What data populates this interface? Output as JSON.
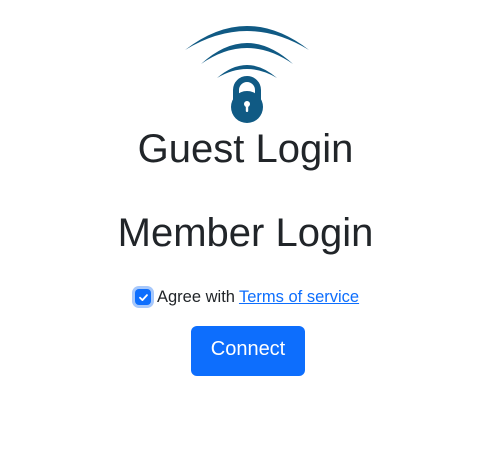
{
  "logo": {
    "icon": "wifi-lock-icon",
    "color": "#105a84"
  },
  "guest_title": "Guest Login",
  "member_title": "Member Login",
  "agree": {
    "checked": true,
    "label": "Agree with",
    "link_text": "Terms of service"
  },
  "connect_button": {
    "label": "Connect"
  },
  "colors": {
    "accent": "#0d6efd",
    "logo": "#105a84",
    "text": "#212529",
    "checkbox_focus_ring": "#a7c8fb"
  }
}
